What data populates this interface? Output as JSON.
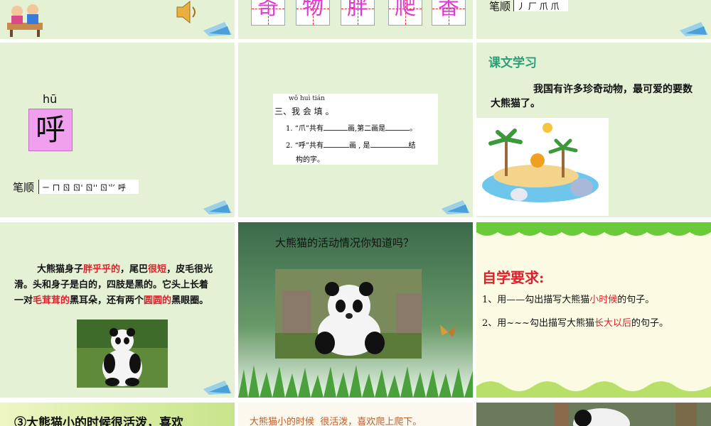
{
  "slides": {
    "s1": {
      "speaker": "speaker-icon"
    },
    "s2": {
      "chars": [
        "奇",
        "物",
        "胖",
        "爬",
        "香"
      ]
    },
    "s3": {
      "label": "笔顺",
      "strokes": "丿 厂 爪 爪"
    },
    "s4": {
      "pinyin": "hū",
      "char": "呼",
      "label": "笔顺",
      "strokes": "ㄧ ㄇ ㄖ ㄖ' ㄖ'' ㄖ⺌ 呼"
    },
    "s5": {
      "pinyin": "wǒ huì tián",
      "heading": "三、我 会 填 。",
      "q1": "1. “爪”共有",
      "q1b": "画,第二画是",
      "q1c": "。",
      "q2": "2. “呼”共有",
      "q2b": "画 , 是",
      "q2c": "结",
      "q2d": "构的字。"
    },
    "s6": {
      "title": "课文学习",
      "text": "我国有许多珍奇动物，最可爱的要数大熊猫了。"
    },
    "s7": {
      "p1": "大熊猫身子",
      "h1": "胖乎乎的",
      "p2": "，尾巴",
      "h2": "很短",
      "p3": "，皮毛很光滑。头和身子是白的，四肢是黑的。它头上长着一对",
      "h3": "毛茸茸的",
      "p4": "黑耳朵，还有两个",
      "h4": "圆圆的",
      "p5": "黑眼圈。"
    },
    "s8": {
      "title": "大熊猫的活动情况你知道吗？"
    },
    "s9": {
      "title": "自学要求:",
      "l1a": "1、用——勾出描写大熊猫",
      "l1b": "小时候",
      "l1c": "的句子。",
      "l2a": "2、用~~~勾出描写大熊猫",
      "l2b": "长大以后",
      "l2c": "的句子。"
    },
    "s10": {
      "text": "③大熊猫小的时候很活泼，喜欢"
    },
    "s11": {
      "text": "大熊猫小的时候  很活泼，喜欢爬上爬下。"
    }
  },
  "colors": {
    "slide_bg": "#e4f1d5",
    "accent_pink": "#e13ad4",
    "red": "#e0202a",
    "teal": "#2aa07a"
  }
}
